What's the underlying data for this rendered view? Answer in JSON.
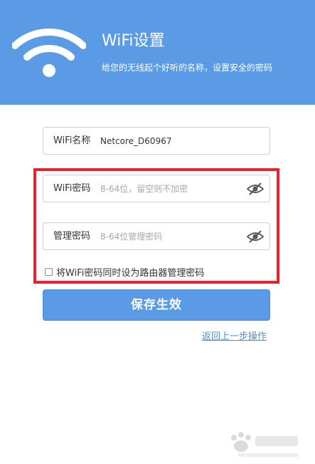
{
  "header": {
    "title": "WiFi设置",
    "subtitle": "给您的无线起个好听的名称，设置安全的密码",
    "bg_color": "#5b9be6",
    "icon": "wifi-icon"
  },
  "form": {
    "wifi_name": {
      "label": "WiFi名称",
      "value": "Netcore_D60967"
    },
    "wifi_password": {
      "label": "WiFi密码",
      "placeholder": "8-64位，留空则不加密",
      "icon": "eye-hidden-icon"
    },
    "admin_password": {
      "label": "管理密码",
      "placeholder": "8-64位管理密码",
      "icon": "eye-hidden-icon"
    },
    "same_password_checkbox": {
      "label": "将WiFi密码同时设为路由器管理密码",
      "checked": false
    },
    "highlight_color": "#e8222d"
  },
  "actions": {
    "save_label": "保存生效",
    "back_label": "返回上一步操作"
  }
}
